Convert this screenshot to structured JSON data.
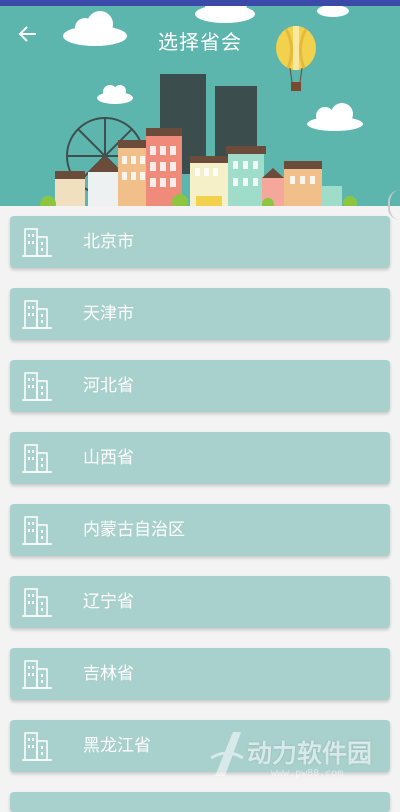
{
  "header": {
    "title": "选择省会",
    "back_icon": "arrow-left-icon",
    "background_color": "#5db6ad"
  },
  "provinces": [
    {
      "label": "北京市",
      "icon": "building-icon"
    },
    {
      "label": "天津市",
      "icon": "building-icon"
    },
    {
      "label": "河北省",
      "icon": "building-icon"
    },
    {
      "label": "山西省",
      "icon": "building-icon"
    },
    {
      "label": "内蒙古自治区",
      "icon": "building-icon"
    },
    {
      "label": "辽宁省",
      "icon": "building-icon"
    },
    {
      "label": "吉林省",
      "icon": "building-icon"
    },
    {
      "label": "黑龙江省",
      "icon": "building-icon"
    }
  ],
  "colors": {
    "row_background": "#a8d0cd",
    "page_background": "#f3f3f3",
    "status_bar": "#3b4aa8"
  },
  "watermark": {
    "text": "动力软件园",
    "url": "www.pw88.com"
  }
}
